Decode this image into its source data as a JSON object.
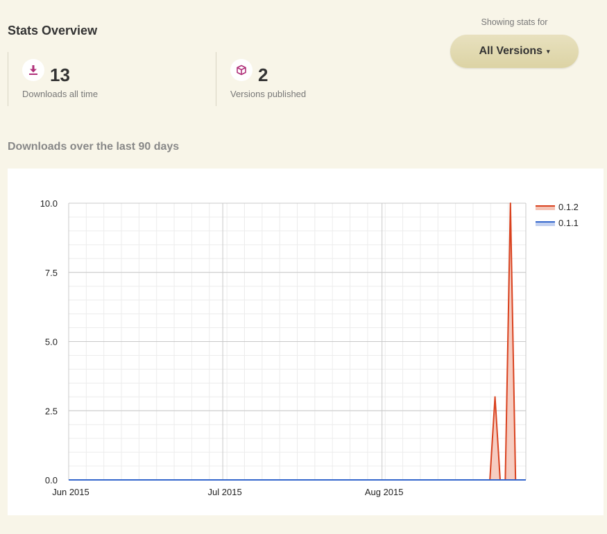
{
  "header": {
    "title": "Stats Overview"
  },
  "stats": [
    {
      "icon": "download-icon",
      "value": "13",
      "label": "Downloads all time"
    },
    {
      "icon": "package-icon",
      "value": "2",
      "label": "Versions published"
    }
  ],
  "version_selector": {
    "caption": "Showing stats for",
    "selected": "All Versions",
    "caret": "▾"
  },
  "section": {
    "title": "Downloads over the last 90 days"
  },
  "colors": {
    "accent_icon": "#b0307a",
    "series_012": "#d9411e",
    "series_012_fill": "#f4c4b6",
    "series_011": "#3366cc",
    "series_011_fill": "#c3d1f0"
  },
  "chart_data": {
    "type": "area",
    "title": "",
    "xlabel": "",
    "ylabel": "",
    "x_ticks": [
      "Jun 2015",
      "Jul 2015",
      "Aug 2015"
    ],
    "y_ticks": [
      "0.0",
      "2.5",
      "5.0",
      "7.5",
      "10.0"
    ],
    "ylim": [
      0,
      10
    ],
    "xlim": [
      "2015-06-01",
      "2015-08-29"
    ],
    "grid": true,
    "legend_position": "top-right",
    "series": [
      {
        "name": "0.1.2",
        "color": "#d9411e",
        "points": [
          {
            "x": "2015-06-01",
            "y": 0
          },
          {
            "x": "2015-08-22",
            "y": 0
          },
          {
            "x": "2015-08-23",
            "y": 3
          },
          {
            "x": "2015-08-24",
            "y": 0
          },
          {
            "x": "2015-08-25",
            "y": 0
          },
          {
            "x": "2015-08-26",
            "y": 10
          },
          {
            "x": "2015-08-27",
            "y": 0
          },
          {
            "x": "2015-08-29",
            "y": 0
          }
        ]
      },
      {
        "name": "0.1.1",
        "color": "#3366cc",
        "points": [
          {
            "x": "2015-06-01",
            "y": 0
          },
          {
            "x": "2015-08-29",
            "y": 0
          }
        ]
      }
    ]
  }
}
